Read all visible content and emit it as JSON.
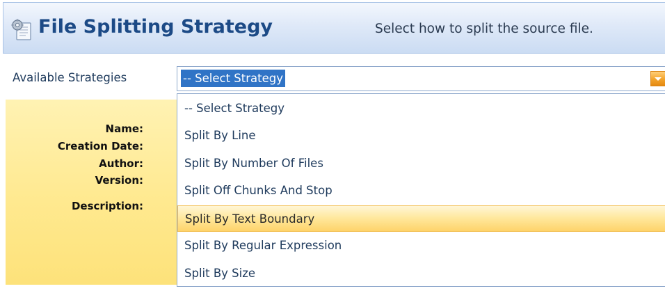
{
  "header": {
    "title": "File Splitting Strategy",
    "subtitle": "Select how to split the source file."
  },
  "strategies": {
    "label": "Available Strategies",
    "selected": "-- Select Strategy",
    "options": [
      "-- Select Strategy",
      "Split By Line",
      "Split By Number Of Files",
      "Split Off Chunks And Stop",
      "Split By Text Boundary",
      "Split By Regular Expression",
      "Split By Size"
    ],
    "highlighted_index": 4
  },
  "details": {
    "name_label": "Name:",
    "creation_date_label": "Creation Date:",
    "author_label": "Author:",
    "version_label": "Version:",
    "description_label": "Description:"
  },
  "colors": {
    "header_title": "#1c4a86",
    "selection_blue": "#3074c6",
    "panel_yellow": "#ffe98f",
    "highlight_orange": "#fed36a"
  }
}
